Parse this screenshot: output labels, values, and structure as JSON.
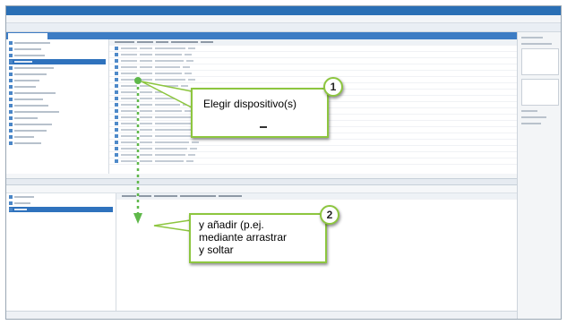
{
  "app": {
    "colors": {
      "titlebar": "#2a6fb5",
      "tab_strip": "#3d7cc4",
      "callout_border": "#8dc63f",
      "flow_arrow": "#5fb84a"
    }
  },
  "callouts": [
    {
      "number": "1",
      "text": "Elegir dispositivo(s)"
    },
    {
      "number": "2",
      "text": "y añadir (p.ej.\nmediante arrastrar\ny soltar"
    }
  ],
  "icons": {
    "arrow": "dashed-down-arrow-icon",
    "dash": "dash-icon"
  }
}
